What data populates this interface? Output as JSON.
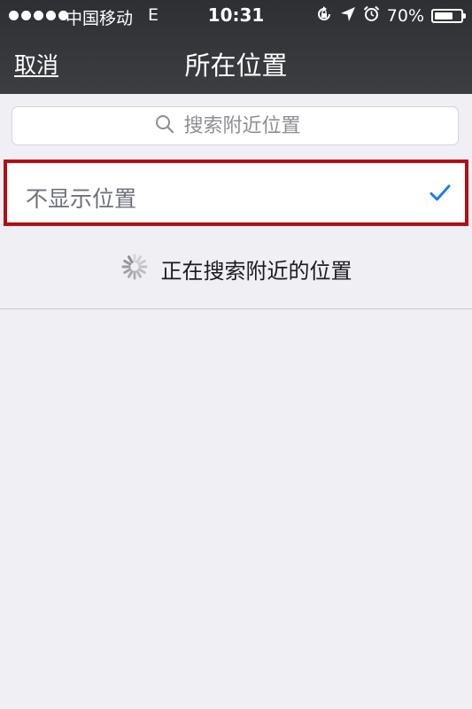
{
  "status_bar": {
    "carrier": "中国移动",
    "network": "E",
    "time": "10:31",
    "battery_percent": "70%",
    "battery_level": 0.7
  },
  "nav": {
    "cancel_label": "取消",
    "title": "所在位置"
  },
  "search": {
    "placeholder": "搜索附近位置"
  },
  "option": {
    "label": "不显示位置",
    "selected": true
  },
  "loading": {
    "text": "正在搜索附近的位置"
  },
  "colors": {
    "accent": "#1a7cf0",
    "highlight_border": "#b30e12",
    "background": "#efeff4"
  }
}
